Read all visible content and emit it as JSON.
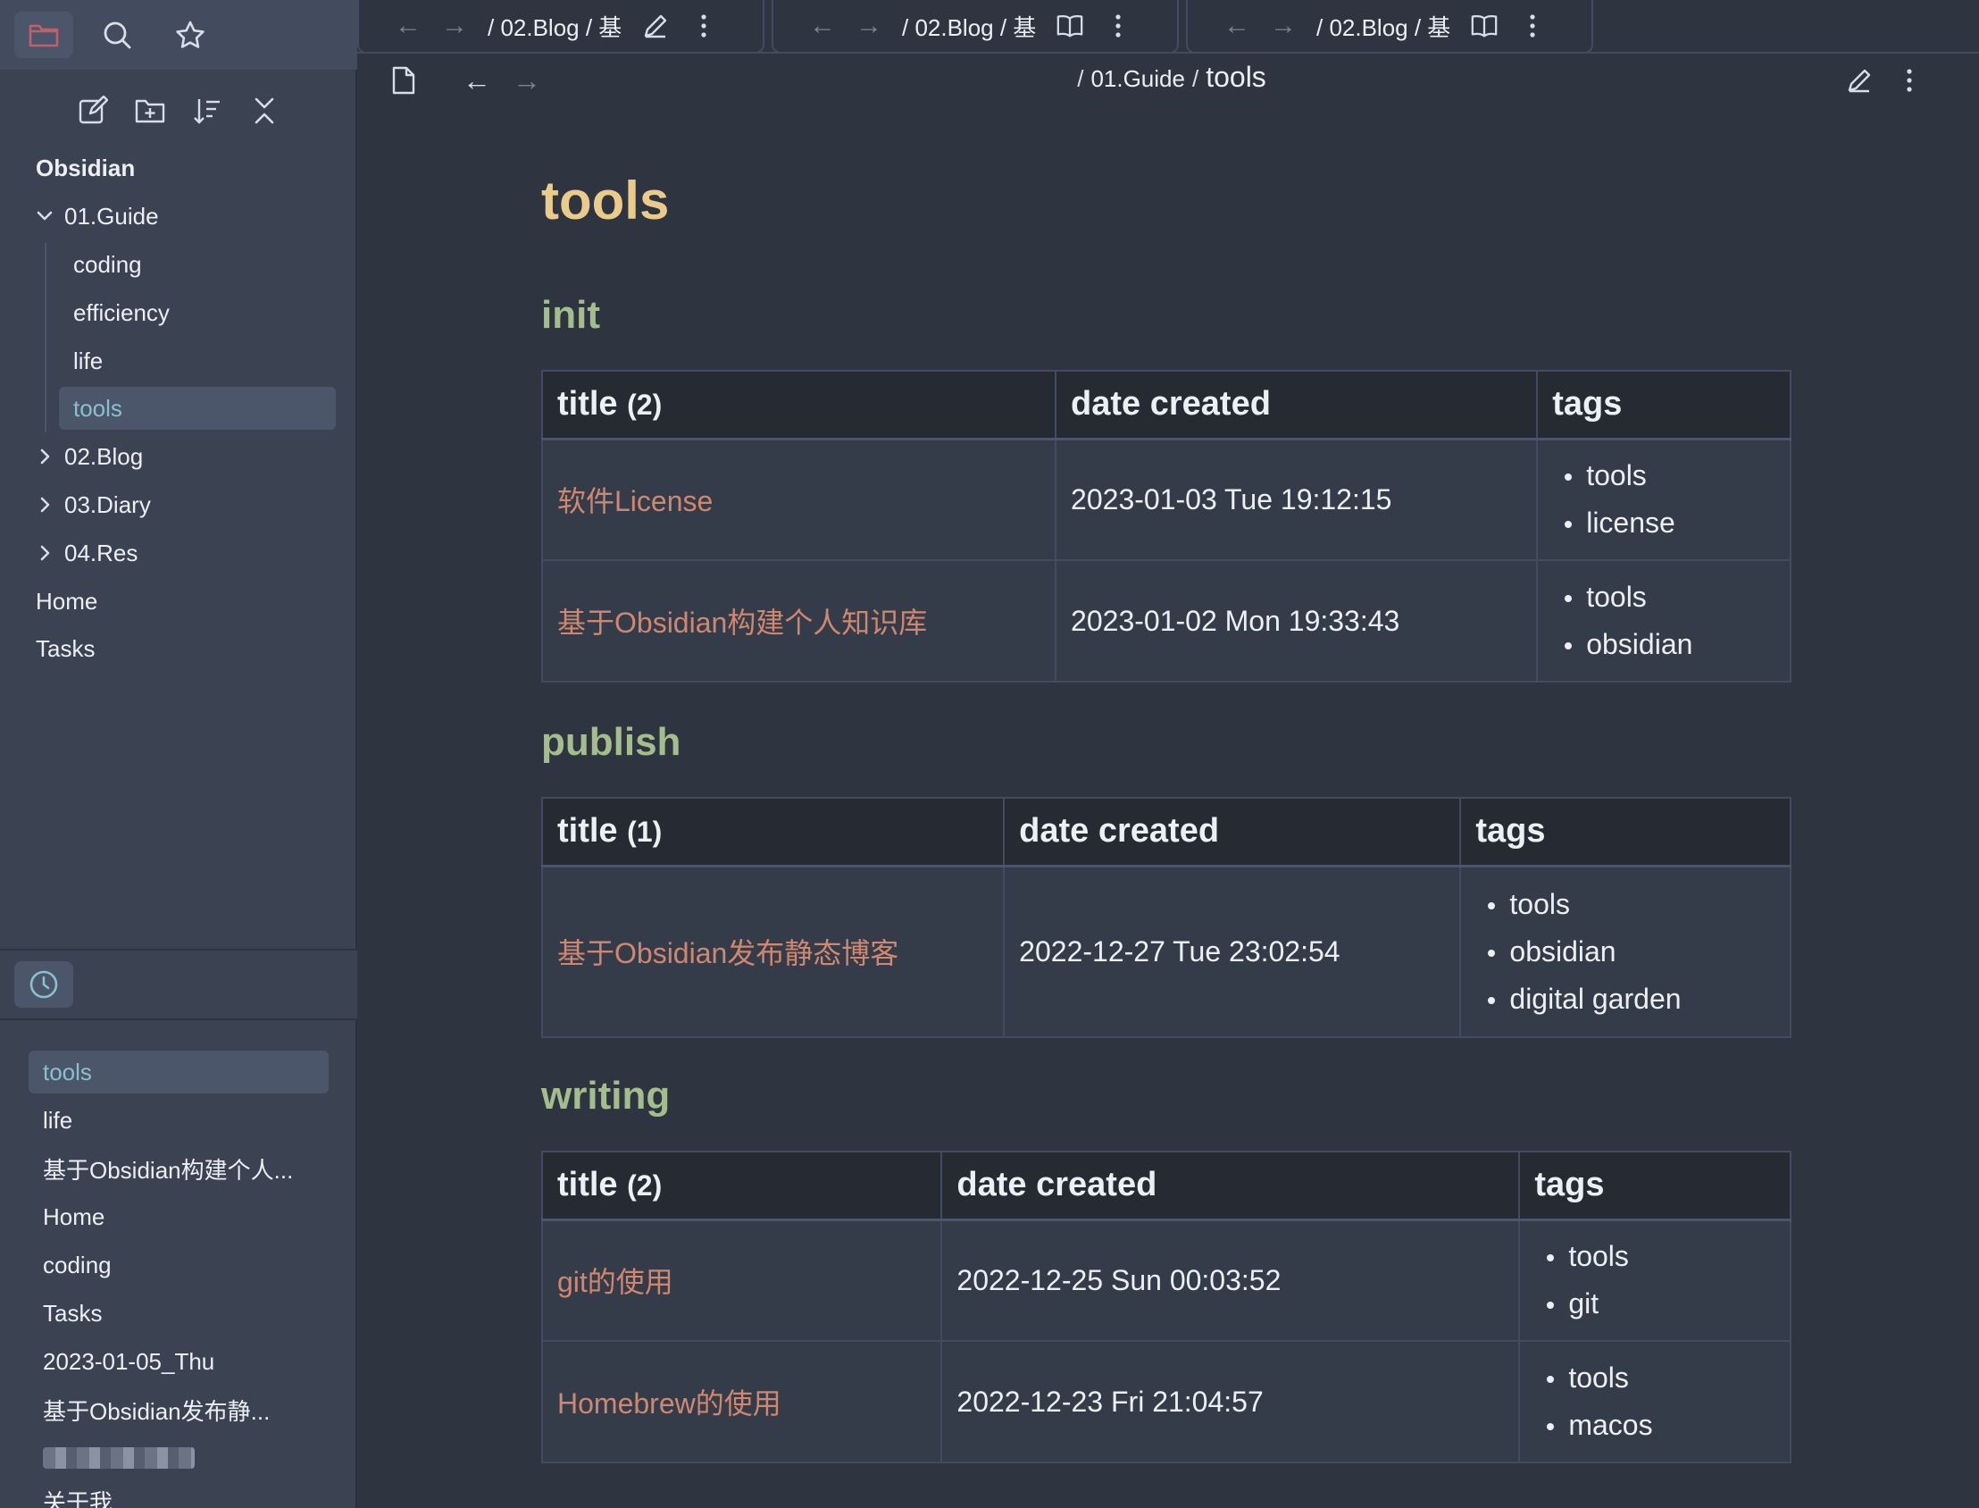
{
  "sidebar": {
    "icons": [
      "folder-icon",
      "search-icon",
      "star-icon"
    ],
    "toolbar_icons": [
      "new-note-icon",
      "new-folder-icon",
      "sort-icon",
      "collapse-all-icon"
    ],
    "vault_name": "Obsidian",
    "folders": {
      "guide": "01.Guide",
      "guide_children": [
        "coding",
        "efficiency",
        "life",
        "tools"
      ],
      "blog": "02.Blog",
      "diary": "03.Diary",
      "res": "04.Res"
    },
    "top_files": [
      "Home",
      "Tasks"
    ],
    "recent": {
      "icon": "clock-icon",
      "items": [
        "tools",
        "life",
        "基于Obsidian构建个人...",
        "Home",
        "coding",
        "Tasks",
        "2023-01-05_Thu",
        "基于Obsidian发布静...",
        "",
        "关于我"
      ]
    }
  },
  "tabs": [
    {
      "path": "/ 02.Blog / 基",
      "mode_icon": "edit-icon"
    },
    {
      "path": "/ 02.Blog / 基",
      "mode_icon": "book-open-icon"
    },
    {
      "path": "/ 02.Blog / 基",
      "mode_icon": "book-open-icon"
    }
  ],
  "view": {
    "breadcrumb_parent": "01.Guide",
    "breadcrumb_sep": "/",
    "current": "tools"
  },
  "note": {
    "title": "tools",
    "sections": [
      {
        "heading": "init",
        "headers": {
          "title": "title",
          "count": "(2)",
          "date": "date created",
          "tags": "tags"
        },
        "rows": [
          {
            "title": "软件License",
            "date": "2023-01-03 Tue 19:12:15",
            "tags": [
              "tools",
              "license"
            ]
          },
          {
            "title": "基于Obsidian构建个人知识库",
            "date": "2023-01-02 Mon 19:33:43",
            "tags": [
              "tools",
              "obsidian"
            ]
          }
        ]
      },
      {
        "heading": "publish",
        "headers": {
          "title": "title",
          "count": "(1)",
          "date": "date created",
          "tags": "tags"
        },
        "rows": [
          {
            "title": "基于Obsidian发布静态博客",
            "date": "2022-12-27 Tue 23:02:54",
            "tags": [
              "tools",
              "obsidian",
              "digital garden"
            ]
          }
        ]
      },
      {
        "heading": "writing",
        "headers": {
          "title": "title",
          "count": "(2)",
          "date": "date created",
          "tags": "tags"
        },
        "rows": [
          {
            "title": "git的使用",
            "date": "2022-12-25 Sun 00:03:52",
            "tags": [
              "tools",
              "git"
            ]
          },
          {
            "title": "Homebrew的使用",
            "date": "2022-12-23 Fri 21:04:57",
            "tags": [
              "tools",
              "macos"
            ]
          }
        ]
      }
    ]
  }
}
